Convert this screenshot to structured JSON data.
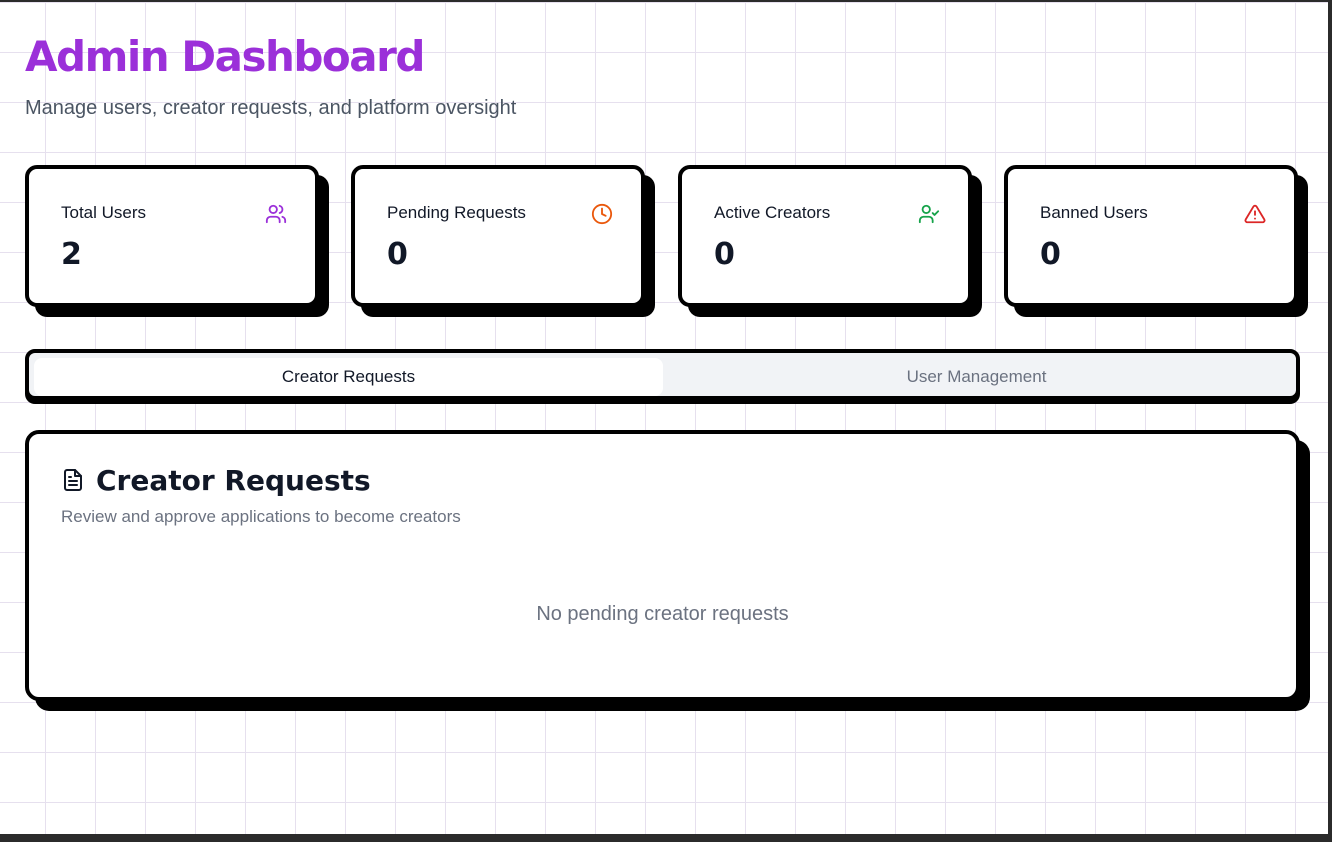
{
  "header": {
    "title": "Admin Dashboard",
    "subtitle": "Manage users, creator requests, and platform oversight"
  },
  "stats": [
    {
      "label": "Total Users",
      "value": "2",
      "icon": "users-icon",
      "color": "#9b30d9"
    },
    {
      "label": "Pending Requests",
      "value": "0",
      "icon": "clock-icon",
      "color": "#ea580c"
    },
    {
      "label": "Active Creators",
      "value": "0",
      "icon": "user-check-icon",
      "color": "#16a34a"
    },
    {
      "label": "Banned Users",
      "value": "0",
      "icon": "alert-triangle-icon",
      "color": "#dc2626"
    }
  ],
  "tabs": [
    {
      "label": "Creator Requests",
      "active": true
    },
    {
      "label": "User Management",
      "active": false
    }
  ],
  "panel": {
    "icon": "file-text-icon",
    "title": "Creator Requests",
    "subtitle": "Review and approve applications to become creators",
    "empty_message": "No pending creator requests"
  },
  "colors": {
    "accent": "#9b30d9",
    "border": "#000000",
    "muted_text": "#6b7280"
  }
}
